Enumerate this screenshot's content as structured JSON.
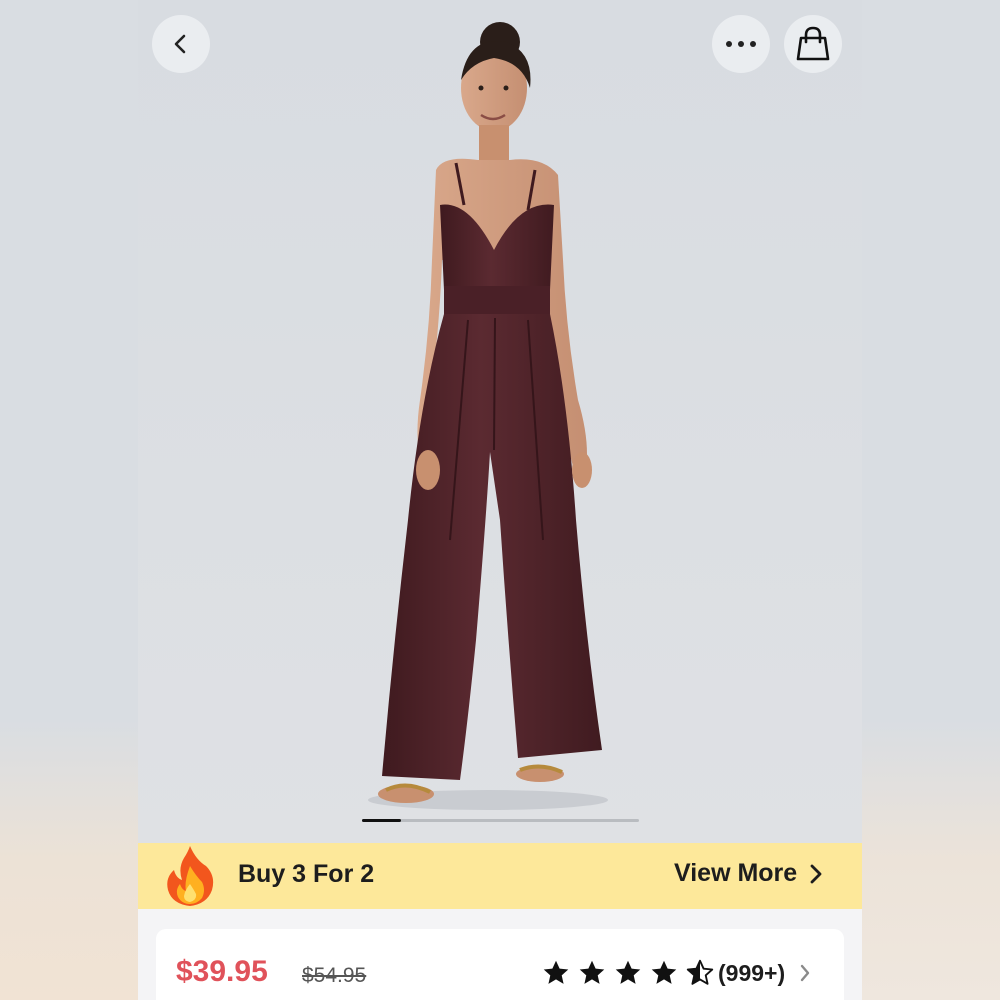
{
  "header": {
    "back_icon": "chevron-left-icon",
    "more_icon": "more-dots-icon",
    "bag_icon": "shopping-bag-icon"
  },
  "hero": {
    "image": "Model wearing a burgundy V-neck wide-leg jumpsuit",
    "carousel_position": 0.14
  },
  "promo": {
    "icon": "fire-icon",
    "text": "Buy 3 For 2",
    "link_label": "View More",
    "background": "#fde89a"
  },
  "product": {
    "price": "$39.95",
    "original_price": "$54.95",
    "price_color": "#e0525a",
    "rating": 4.5,
    "review_count": "(999+)"
  }
}
